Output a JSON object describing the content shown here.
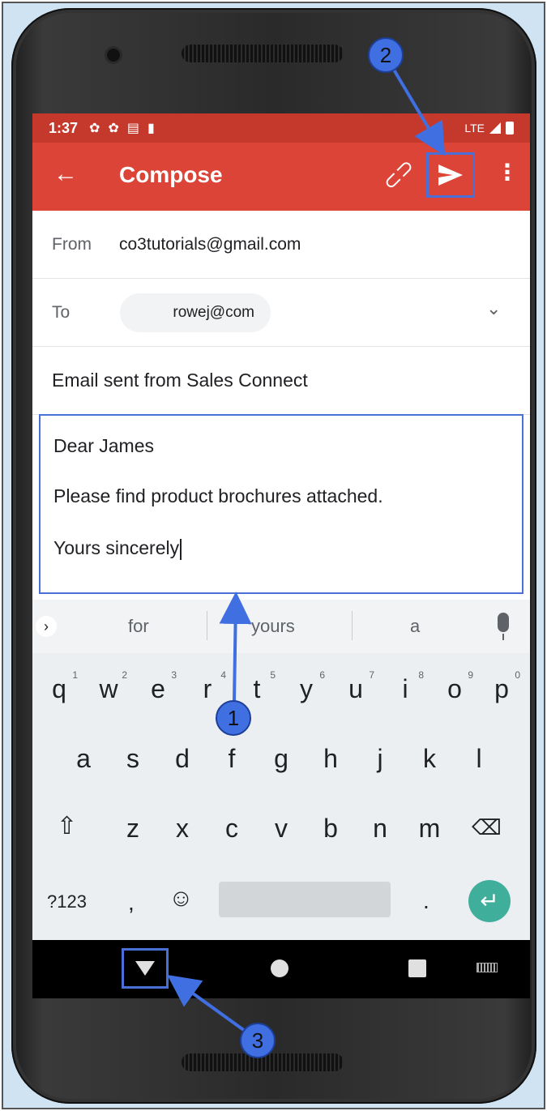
{
  "status_bar": {
    "time": "1:37",
    "network": "LTE"
  },
  "app_bar": {
    "title": "Compose",
    "back_icon": "arrow-left-icon",
    "attach_icon": "paperclip-icon",
    "send_icon": "send-icon",
    "more_icon": "more-vert-icon"
  },
  "compose": {
    "from_label": "From",
    "from_value": "co3tutorials@gmail.com",
    "to_label": "To",
    "to_chip": "rowej@com",
    "subject": "Email sent from Sales Connect",
    "body_lines": [
      "Dear James",
      "Please find product brochures attached.",
      "Yours sincerely"
    ]
  },
  "suggestions": [
    "for",
    "yours",
    "a"
  ],
  "keyboard": {
    "row1": [
      "q",
      "w",
      "e",
      "r",
      "t",
      "y",
      "u",
      "i",
      "o",
      "p"
    ],
    "row1_hints": [
      "1",
      "2",
      "3",
      "4",
      "5",
      "6",
      "7",
      "8",
      "9",
      "0"
    ],
    "row2": [
      "a",
      "s",
      "d",
      "f",
      "g",
      "h",
      "j",
      "k",
      "l"
    ],
    "row3": [
      "z",
      "x",
      "c",
      "v",
      "b",
      "n",
      "m"
    ],
    "symbols_key": "?123",
    "comma_key": ",",
    "period_key": "."
  },
  "callouts": [
    "1",
    "2",
    "3"
  ],
  "colors": {
    "status_bar": "#c5382c",
    "app_bar": "#db4437",
    "highlight": "#4a6fd6",
    "enter_key": "#3fae9a"
  }
}
